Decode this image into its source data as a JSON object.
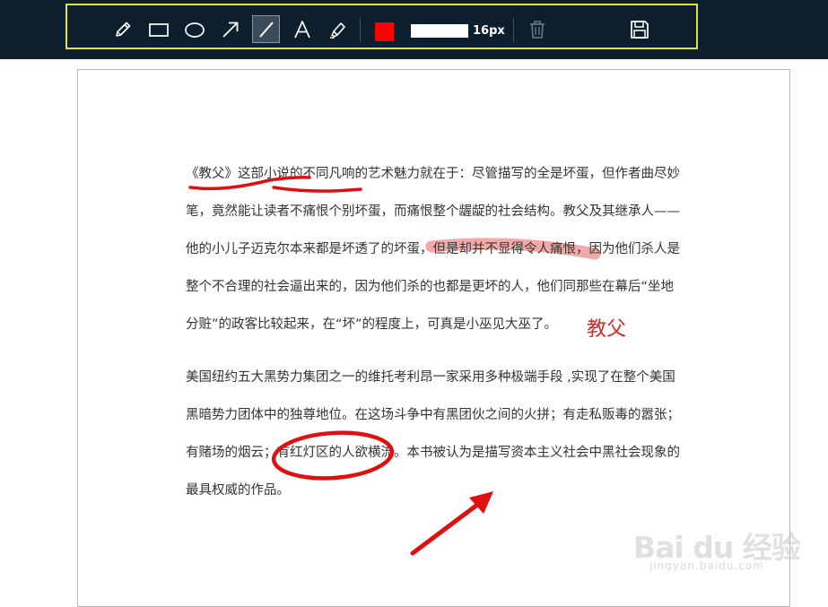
{
  "toolbar": {
    "tools": [
      {
        "name": "pencil-icon"
      },
      {
        "name": "rectangle-icon"
      },
      {
        "name": "ellipse-icon"
      },
      {
        "name": "arrow-icon"
      },
      {
        "name": "line-icon",
        "active": true
      },
      {
        "name": "text-icon"
      },
      {
        "name": "highlighter-icon"
      }
    ],
    "color": "#ff0000",
    "line_width_label": "16px",
    "delete_icon": "trash-icon",
    "save_icon": "save-icon"
  },
  "document": {
    "paragraph1_lines": [
      "《教父》这部小说的不同凡响的艺术魅力就在于：尽管描写的全是坏蛋，但作者曲尽妙",
      "笔，竟然能让读者不痛恨个别坏蛋，而痛恨整个龌龊的社会结构。教父及其继承人——",
      "他的小儿子迈克尔本来都是坏透了的坏蛋，但是却并不显得令人痛恨，因为他们杀人是",
      "整个不合理的社会逼出来的，因为他们杀的也都是更坏的人，他们同那些在幕后“坐地",
      "分赃”的政客比较起来，在“坏”的程度上，可真是小巫见大巫了。"
    ],
    "paragraph2_lines": [
      "美国纽约五大黑势力集团之一的维托考利昂一家采用多种极端手段 ,实现了在整个美国",
      "黑暗势力团体中的独尊地位。在这场斗争中有黑团伙之间的火拼；有走私贩毒的嚣张；",
      "有赌场的烟云；有红灯区的人欲横流。本书被认为是描写资本主义社会中黑社会现象的",
      "最具权威的作品。"
    ]
  },
  "annotations": {
    "text_label": "教父",
    "stroke_color": "#e01010",
    "highlight_color": "#f29a9a"
  },
  "watermark": {
    "logo_text": "Bai du 经验",
    "sub_text": "jingyan.baidu.com"
  }
}
